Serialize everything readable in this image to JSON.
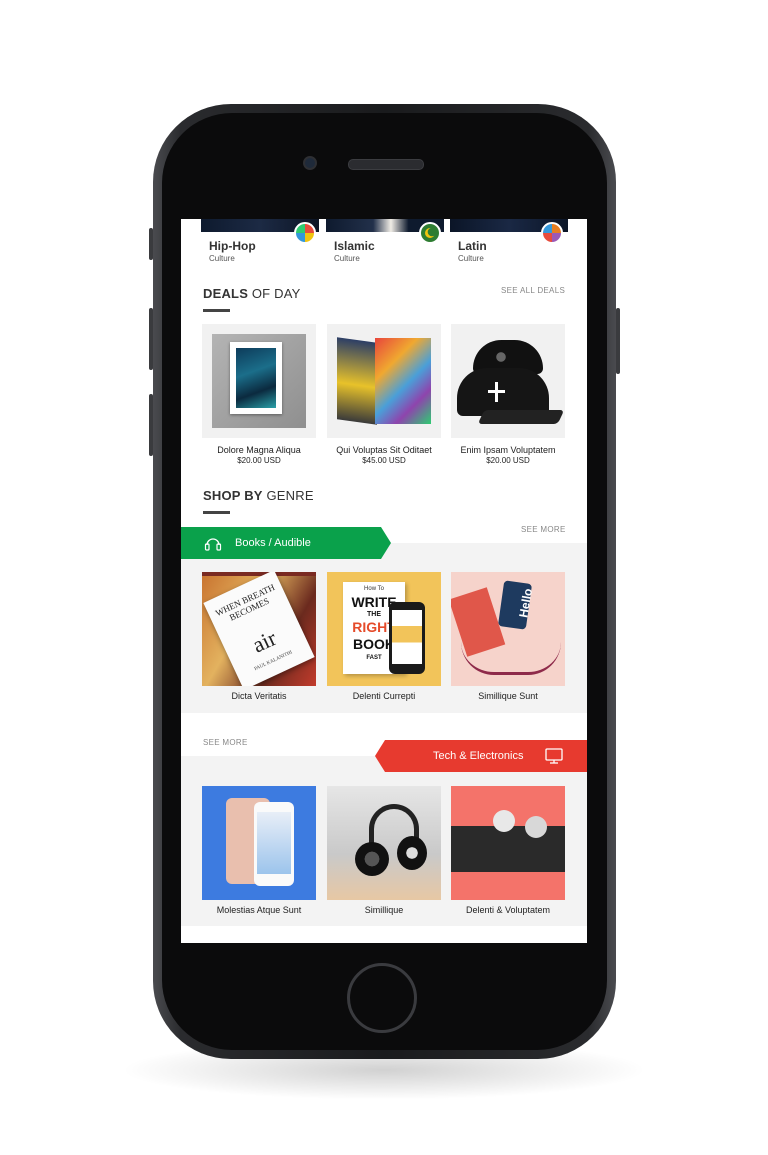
{
  "cultures": [
    {
      "name": "Hip-Hop",
      "sub": "Culture"
    },
    {
      "name": "Islamic",
      "sub": "Culture"
    },
    {
      "name": "Latin",
      "sub": "Culture"
    }
  ],
  "deals": {
    "title_bold": "DEALS",
    "title_rest": " OF DAY",
    "see_all": "SEE ALL DEALS",
    "products": [
      {
        "name": "Dolore Magna Aliqua",
        "price": "$20.00 USD"
      },
      {
        "name": "Qui Voluptas Sit Oditaet",
        "price": "$45.00 USD"
      },
      {
        "name": "Enim Ipsam Voluptatem",
        "price": "$20.00 USD"
      }
    ]
  },
  "genre": {
    "title_bold": "SHOP BY",
    "title_rest": " GENRE"
  },
  "books": {
    "label": "Books / Audible",
    "see_more": "SEE MORE",
    "accent": "#0aa14b",
    "icon": "headphones-icon",
    "items": [
      "Dicta Veritatis",
      "Delenti Currepti",
      "Simillique Sunt"
    ]
  },
  "tech": {
    "label": "Tech & Electronics",
    "see_more": "SEE MORE",
    "accent": "#e73a2f",
    "icon": "monitor-icon",
    "items": [
      "Molestias Atque Sunt",
      "Simillique",
      "Delenti & Voluptatem"
    ]
  },
  "book_cover": {
    "title": "WHEN BREATH BECOMES",
    "word": "air",
    "author": "PAUL KALANITHI"
  },
  "write_book": {
    "line1": "How To",
    "line2": "WRITE",
    "line3": "THE",
    "line4": "RIGHT",
    "line5": "BOOK",
    "line6": "FAST"
  },
  "lanyard": {
    "text": "Hello"
  }
}
